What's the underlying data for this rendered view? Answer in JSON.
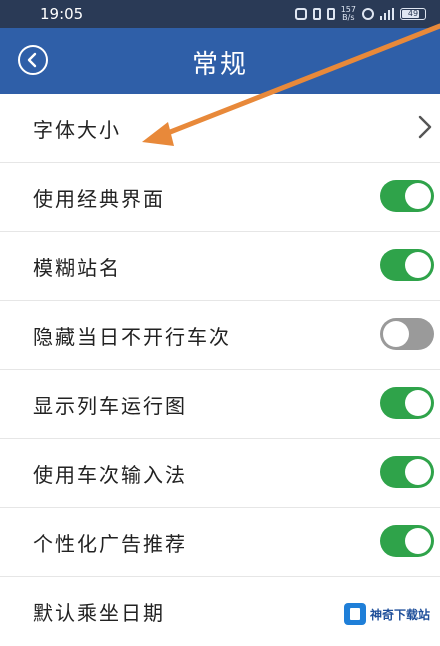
{
  "status_bar": {
    "time": "19:05",
    "network_speed_top": "157",
    "network_speed_bottom": "B/s",
    "battery_level": "49"
  },
  "header": {
    "title": "常规",
    "back_icon": "back-arrow-circle-icon"
  },
  "settings": [
    {
      "label": "字体大小",
      "control": "chevron",
      "icon": "chevron-right-icon"
    },
    {
      "label": "使用经典界面",
      "control": "switch",
      "on": true
    },
    {
      "label": "模糊站名",
      "control": "switch",
      "on": true
    },
    {
      "label": "隐藏当日不开行车次",
      "control": "switch",
      "on": false
    },
    {
      "label": "显示列车运行图",
      "control": "switch",
      "on": true
    },
    {
      "label": "使用车次输入法",
      "control": "switch",
      "on": true
    },
    {
      "label": "个性化广告推荐",
      "control": "switch",
      "on": true
    },
    {
      "label": "默认乘坐日期",
      "control": "none"
    }
  ],
  "colors": {
    "status_bar": "#2a3a56",
    "header": "#2f5fa8",
    "switch_on": "#2fa34a",
    "switch_off": "#9a9a9a",
    "annotation_arrow": "#e8893a"
  },
  "watermark": {
    "text": "神奇下载站"
  }
}
